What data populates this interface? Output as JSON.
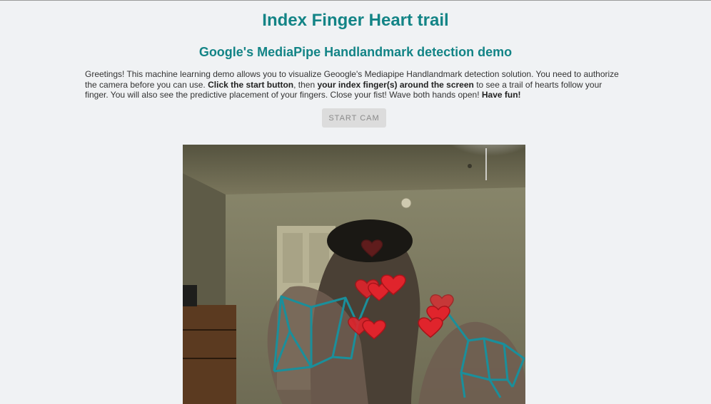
{
  "header": {
    "title": "Index Finger Heart trail",
    "subtitle": "Google's MediaPipe Handlandmark detection demo"
  },
  "intro": {
    "p1": "Greetings! This machine learning demo allows you to visualize Geoogle's Mediapipe Handlandmark detection solution. You need to authorize the camera before you can use. ",
    "b1": "Click the start button",
    "p2": ", then ",
    "b2": "your index finger(s) around the screen",
    "p3": " to see a trail of hearts follow your finger. You will also see the predictive placement of your fingers. Close your fist! Wave both hands open! ",
    "b3": "Have fun!"
  },
  "controls": {
    "start_label": "START CAM"
  },
  "colors": {
    "accent": "#138486",
    "landmark_line": "#1a8f9b",
    "heart": "#e0242c"
  }
}
